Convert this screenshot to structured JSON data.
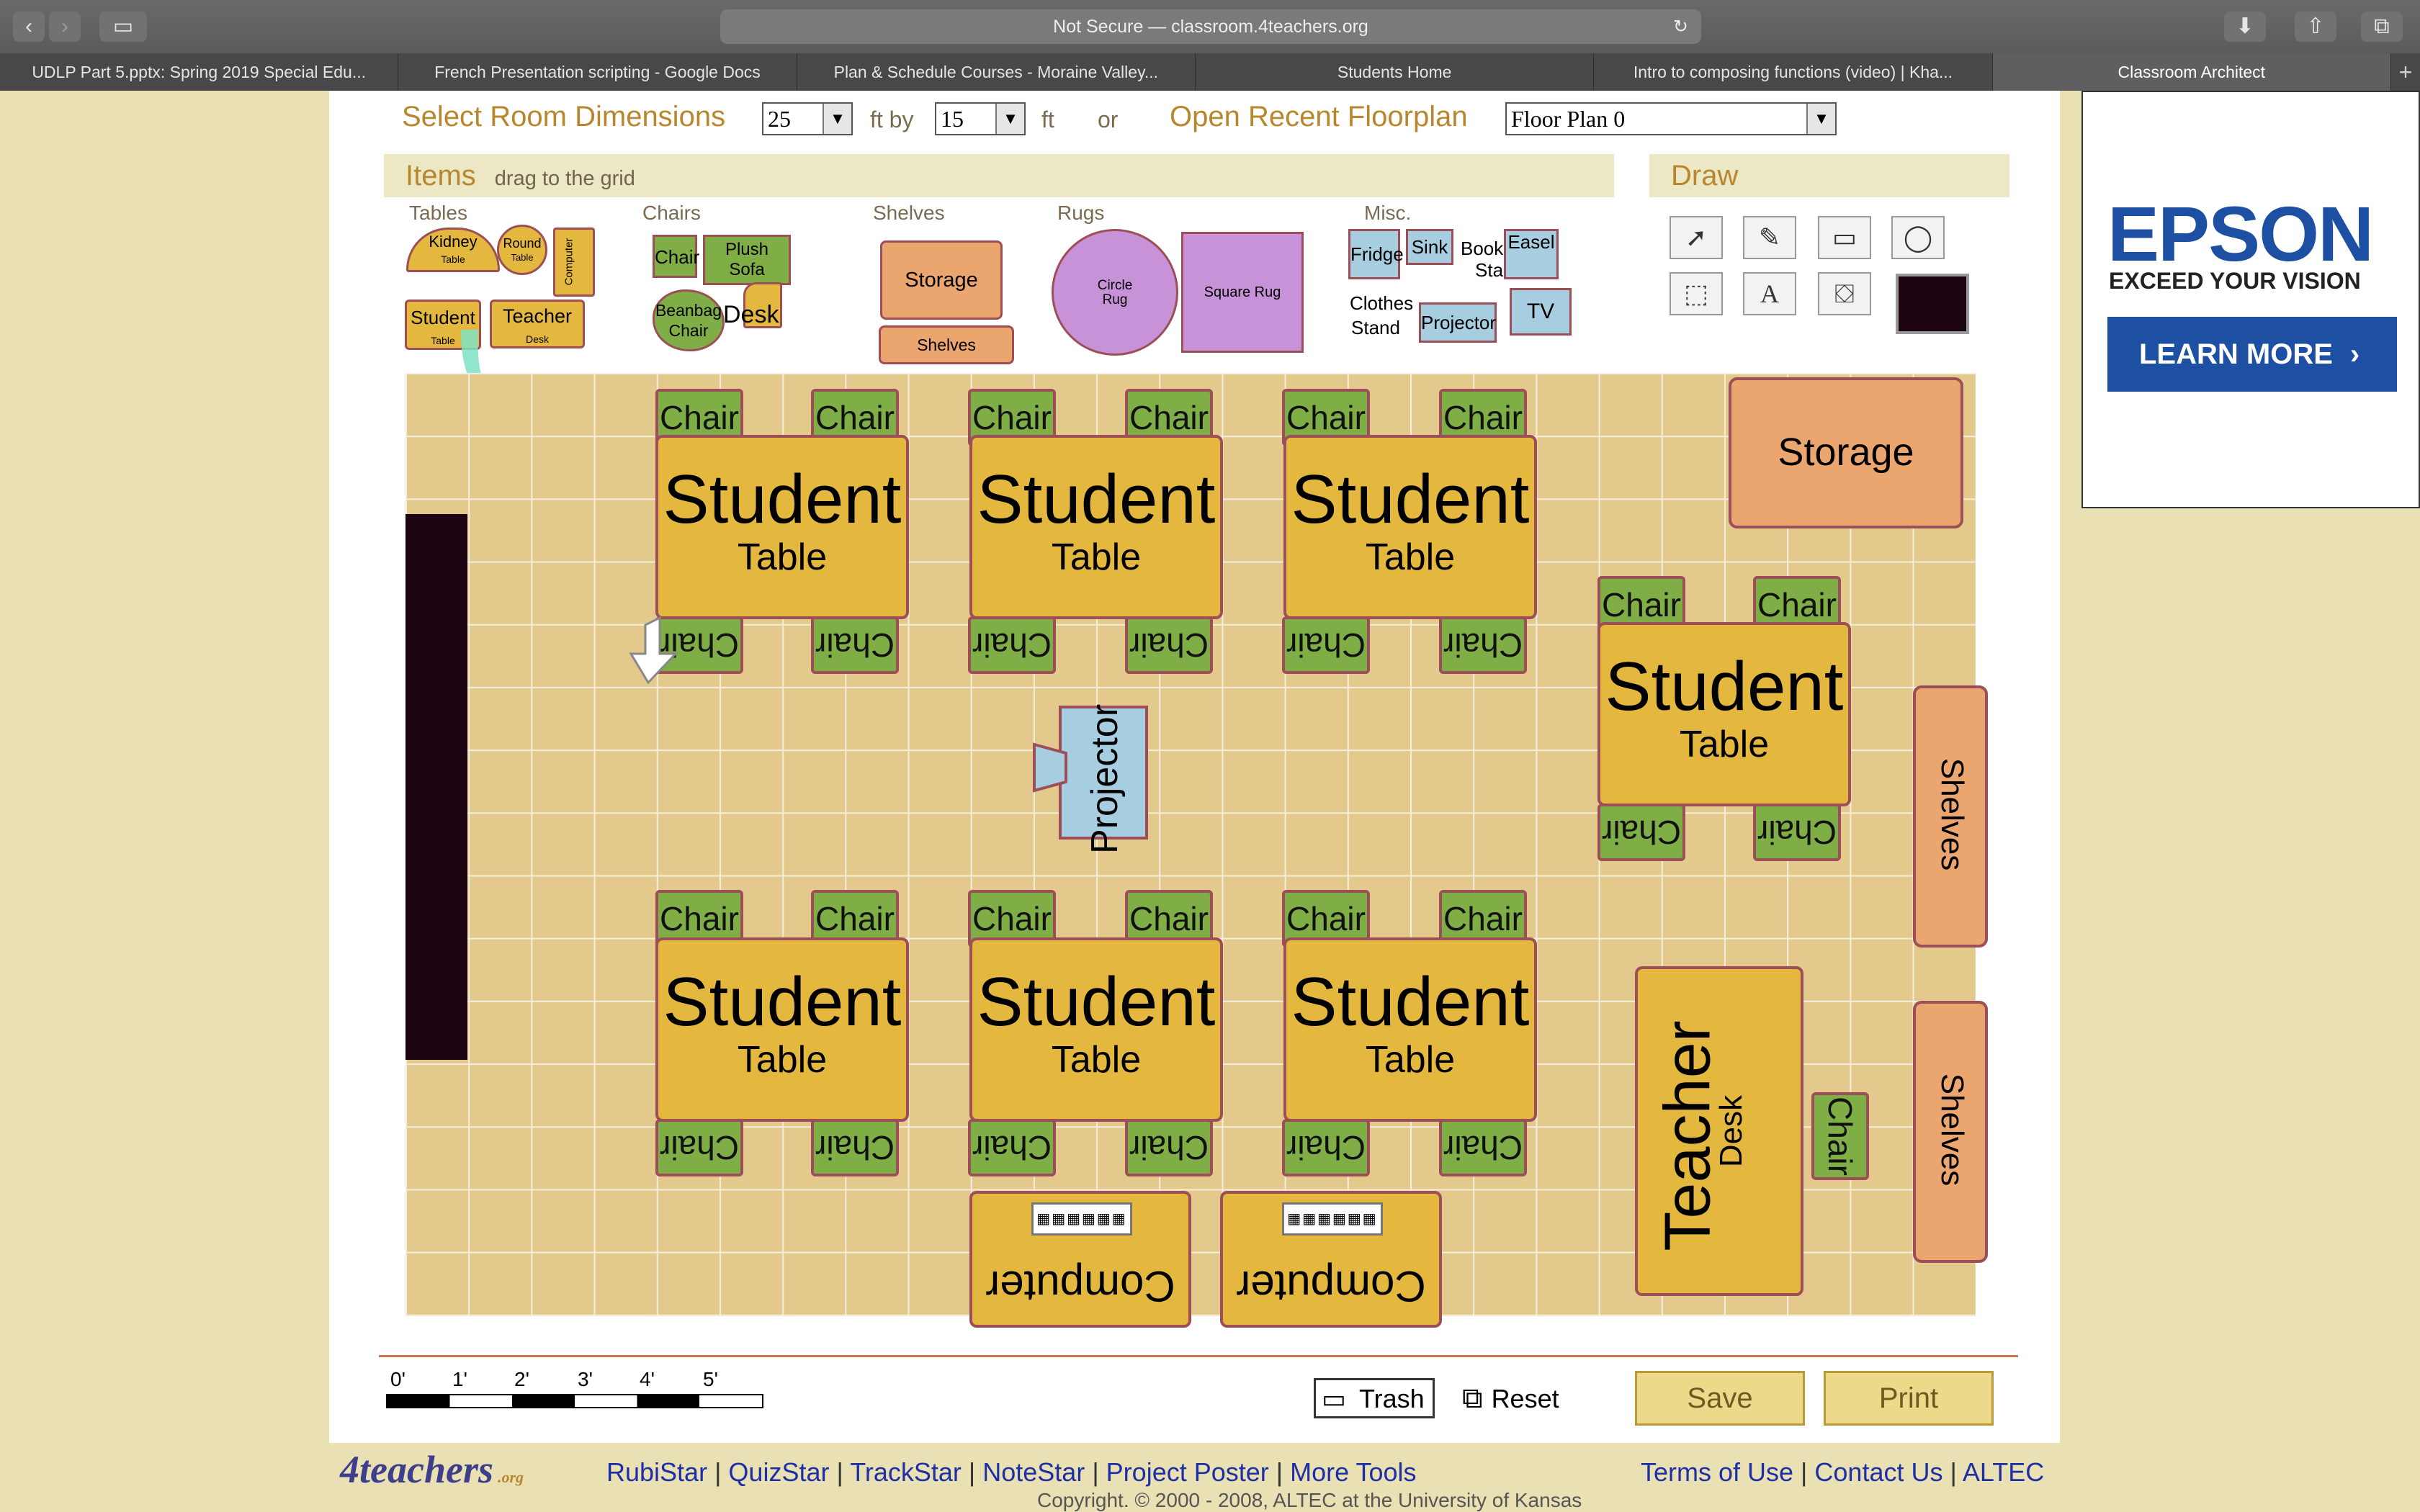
{
  "browser": {
    "url": "Not Secure — classroom.4teachers.org",
    "tabs": [
      "UDLP Part 5.pptx: Spring 2019 Special Edu...",
      "French Presentation scripting - Google Docs",
      "Plan & Schedule Courses - Moraine Valley...",
      "Students Home",
      "Intro to composing functions (video) | Kha...",
      "Classroom Architect"
    ],
    "active_tab": "Classroom Architect"
  },
  "header": {
    "dims_label": "Select Room Dimensions",
    "width_value": "25",
    "ft_by": "ft by",
    "height_value": "15",
    "ft": "ft",
    "or": "or",
    "recent_label": "Open Recent Floorplan",
    "floorplan_value": "Floor Plan 0"
  },
  "items_panel": {
    "title": "Items",
    "hint": "drag to the grid",
    "categories": [
      "Tables",
      "Chairs",
      "Shelves",
      "Rugs",
      "Misc."
    ],
    "tables": {
      "kidney": "Kidney",
      "kidney_sub": "Table",
      "round": "Round",
      "round_sub": "Table",
      "computer": "Computer",
      "student": "Student",
      "student_sub": "Table",
      "teacher": "Teacher",
      "teacher_sub": "Desk"
    },
    "chairs": {
      "chair": "Chair",
      "plush": "Plush",
      "sofa": "Sofa",
      "beanbag": "Beanbag",
      "beanbag2": "Chair",
      "desk": "Desk"
    },
    "shelves": {
      "storage": "Storage",
      "shelves": "Shelves"
    },
    "rugs": {
      "circle": "Circle",
      "circle2": "Rug",
      "square": "Square Rug"
    },
    "misc": {
      "fridge": "Fridge",
      "sink": "Sink",
      "book": "Book",
      "book2": "Stan",
      "easel": "Easel",
      "clothes": "Clothes",
      "clothes2": "Stand",
      "projector": "Projector",
      "tv": "TV"
    }
  },
  "draw_panel": {
    "title": "Draw",
    "text_tool": "A",
    "current_color": "#1c0410"
  },
  "grid": {
    "chair_label": "Chair",
    "student_label": "Student",
    "table_label": "Table",
    "storage_label": "Storage",
    "shelves_label": "Shelves",
    "teacher_label": "Teacher",
    "desk_label": "Desk",
    "projector_label": "Projector",
    "computer_label": "Computer"
  },
  "scale": {
    "marks": [
      "0'",
      "1'",
      "2'",
      "3'",
      "4'",
      "5'"
    ]
  },
  "actions": {
    "trash": "Trash",
    "reset": "Reset",
    "save": "Save",
    "print": "Print"
  },
  "footer": {
    "logo": "4teachers",
    "logo_small": ".org",
    "links": [
      "RubiStar",
      "QuizStar",
      "TrackStar",
      "NoteStar",
      "Project Poster",
      "More Tools"
    ],
    "right_links": [
      "Terms of Use",
      "Contact Us",
      "ALTEC"
    ],
    "copyright": "Copyright. © 2000 - 2008, ALTEC at the University of Kansas"
  },
  "ad": {
    "brand": "EPSON",
    "tagline": "EXCEED YOUR VISION",
    "cta": "LEARN MORE"
  },
  "colors": {
    "accent": "#b8862c",
    "grid": "#e4c98c",
    "table": "#e4b83f",
    "chair": "#7fae47",
    "link": "#1e2fa6",
    "epson_blue": "#1d4fa3"
  }
}
